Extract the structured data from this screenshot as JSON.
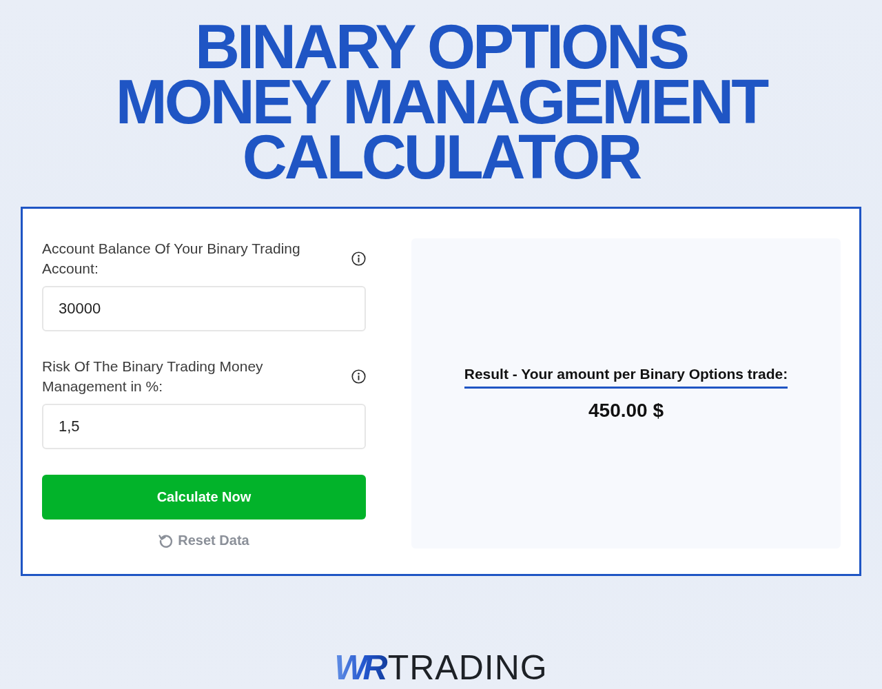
{
  "title": {
    "lines": [
      "BINARY OPTIONS",
      "MONEY MANAGEMENT",
      "CALCULATOR"
    ]
  },
  "form": {
    "fields": [
      {
        "label": "Account Balance Of Your Binary Trading Account:",
        "value": "30000"
      },
      {
        "label": "Risk Of The Binary Trading Money Management in %:",
        "value": "1,5"
      }
    ],
    "submit_button": "Calculate Now",
    "reset_link": "Reset Data"
  },
  "result": {
    "heading": "Result - Your amount per Binary Options trade:",
    "value": "450.00 $"
  },
  "footer_logo": {
    "mark": "WR",
    "wordmark": "TRADING"
  }
}
